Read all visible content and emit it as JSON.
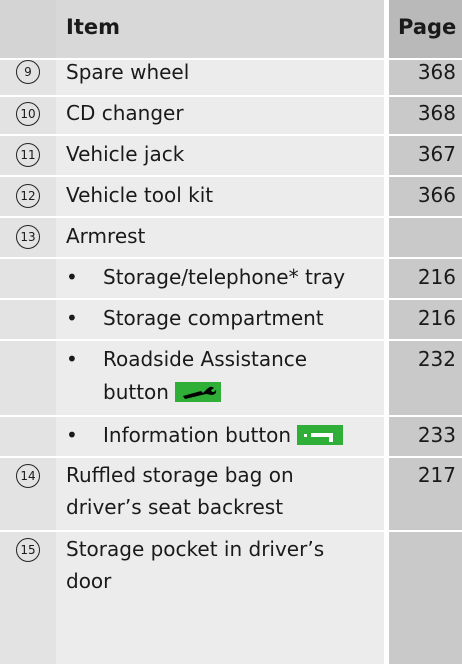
{
  "header": {
    "item": "Item",
    "page": "Page"
  },
  "rows": [
    {
      "num": "9",
      "label": "Spare wheel",
      "page": "368"
    },
    {
      "num": "10",
      "label": "CD changer",
      "page": "368"
    },
    {
      "num": "11",
      "label": "Vehicle jack",
      "page": "367"
    },
    {
      "num": "12",
      "label": "Vehicle tool kit",
      "page": "366"
    },
    {
      "num": "13",
      "label": "Armrest",
      "page": ""
    }
  ],
  "armrest_sub": [
    {
      "bullet": "•",
      "label": "Storage/telephone* tray",
      "page": "216"
    },
    {
      "bullet": "•",
      "label": "Storage compartment",
      "page": "216"
    },
    {
      "bullet": "•",
      "label_line1": "Roadside Assistance",
      "label_line2": "button",
      "page": "232",
      "icon": "wrench-icon"
    },
    {
      "bullet": "•",
      "label": "Information button",
      "page": "233",
      "icon": "info-icon"
    }
  ],
  "rows2": [
    {
      "num": "14",
      "label_line1": "Ruffled storage bag on",
      "label_line2": "driver’s seat backrest",
      "page": "217"
    },
    {
      "num": "15",
      "label_line1": "Storage pocket in driver’s",
      "label_line2": "door",
      "page": ""
    }
  ],
  "colors": {
    "icon_bg": "#2fae38"
  }
}
